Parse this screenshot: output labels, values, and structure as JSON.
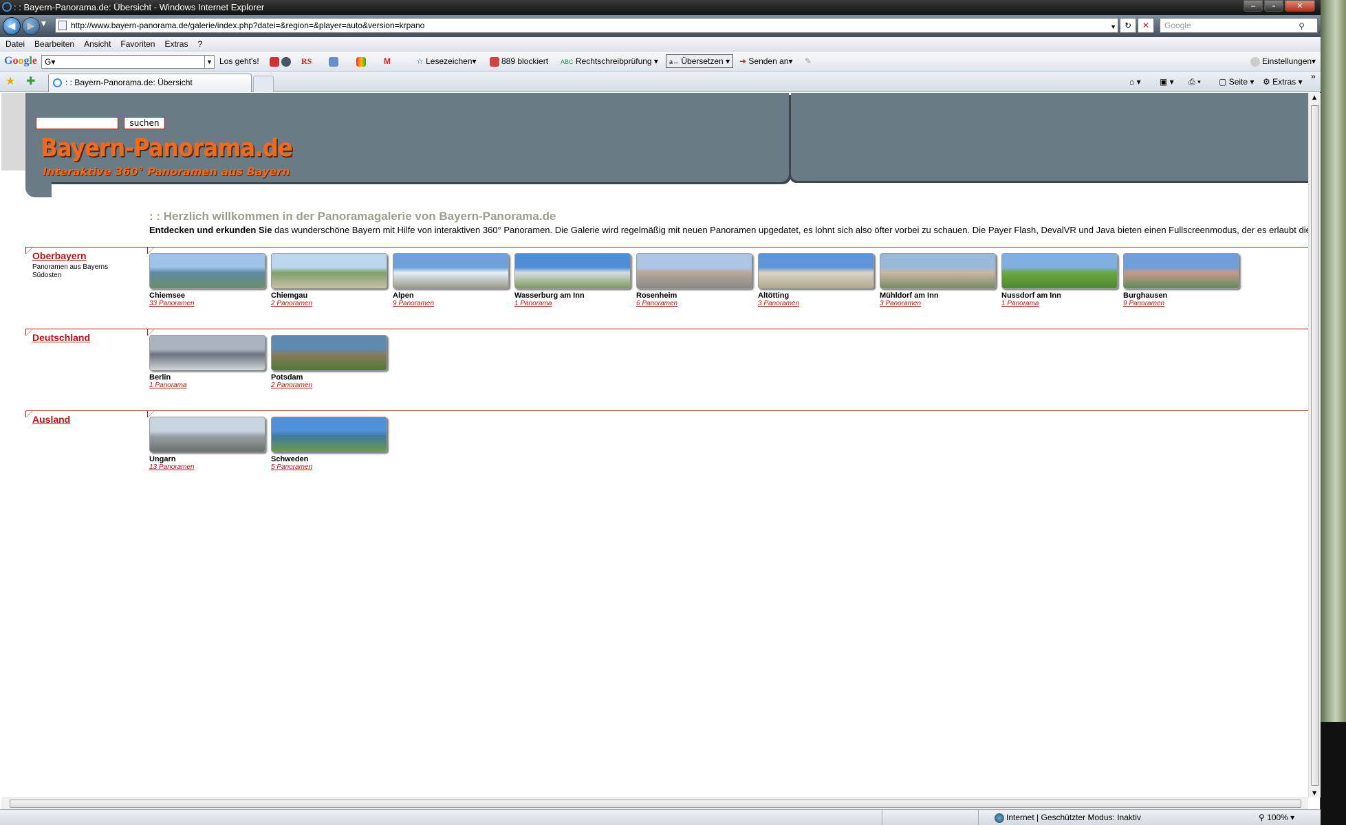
{
  "window": {
    "title": ": : Bayern-Panorama.de: Übersicht - Windows Internet Explorer"
  },
  "address": {
    "url": "http://www.bayern-panorama.de/galerie/index.php?datei=&region=&player=auto&version=krpano",
    "search_placeholder": "Google"
  },
  "menu": [
    "Datei",
    "Bearbeiten",
    "Ansicht",
    "Favoriten",
    "Extras",
    "?"
  ],
  "gbar": {
    "logo": "Google",
    "input": "G▾",
    "go": "Los geht's!",
    "rs": "RS",
    "bookmarks": "Lesezeichen▾",
    "blocked": "889 blockiert",
    "spell": "Rechtschreibprüfung",
    "translate": "Übersetzen",
    "send": "Senden an▾",
    "settings": "Einstellungen▾"
  },
  "tab": {
    "label": ": : Bayern-Panorama.de: Übersicht"
  },
  "cmdbar": {
    "page": "Seite",
    "extras": "Extras"
  },
  "site": {
    "search_button": "suchen",
    "logo": "Bayern-Panorama.de",
    "logo_sub": "Interaktive 360° Panoramen aus Bayern",
    "welcome": ": : Herzlich willkommen in der Panoramagalerie von Bayern-Panorama.de",
    "intro_bold": "Entdecken und erkunden Sie",
    "intro_rest": " das wunderschöne Bayern mit Hilfe von interaktiven 360° Panoramen. Die Galerie wird regelmäßig mit neuen Panoramen upgedatet, es lohnt sich also öfter vorbei zu schauen. Die Payer Flash, DevalVR und Java bieten einen Fullscreenmodus, der es erlaubt die"
  },
  "sections": [
    {
      "title": "Oberbayern",
      "desc": "Panoramen aus Bayerns Südosten",
      "items": [
        {
          "name": "Chiemsee",
          "count": "33 Panoramen",
          "colors": [
            "#9fc2e8",
            "#5e8aa0",
            "#6b8f70"
          ]
        },
        {
          "name": "Chiemgau",
          "count": "2 Panoramen",
          "colors": [
            "#bcd6ee",
            "#7fa06a",
            "#c8c0a8"
          ]
        },
        {
          "name": "Alpen",
          "count": "9 Panoramen",
          "colors": [
            "#6fa0d8",
            "#e6eef4",
            "#9a9a8c"
          ]
        },
        {
          "name": "Wasserburg am Inn",
          "count": "1 Panorama",
          "colors": [
            "#4f8ed6",
            "#d8dde0",
            "#7f9a5e"
          ]
        },
        {
          "name": "Rosenheim",
          "count": "6 Panoramen",
          "colors": [
            "#aec6e6",
            "#b7a89a",
            "#8a8a88"
          ]
        },
        {
          "name": "Altötting",
          "count": "3 Panoramen",
          "colors": [
            "#5f94d6",
            "#dcd4c4",
            "#b0a890"
          ]
        },
        {
          "name": "Mühldorf am Inn",
          "count": "3 Panoramen",
          "colors": [
            "#9ab8d8",
            "#c8b8a0",
            "#7a8a6a"
          ]
        },
        {
          "name": "Nussdorf am Inn",
          "count": "1 Panorama",
          "colors": [
            "#7fb0e0",
            "#6aa840",
            "#4f8a30"
          ]
        },
        {
          "name": "Burghausen",
          "count": "9 Panoramen",
          "colors": [
            "#6f9ed8",
            "#c89a8a",
            "#5f8a5a"
          ]
        }
      ]
    },
    {
      "title": "Deutschland",
      "desc": "",
      "items": [
        {
          "name": "Berlin",
          "count": "1 Panorama",
          "colors": [
            "#aab4c0",
            "#6a7480",
            "#d0d4d8"
          ]
        },
        {
          "name": "Potsdam",
          "count": "2 Panoramen",
          "colors": [
            "#5f8ab0",
            "#8a7a5a",
            "#4f7a3a"
          ]
        }
      ]
    },
    {
      "title": "Ausland",
      "desc": "",
      "items": [
        {
          "name": "Ungarn",
          "count": "13 Panoramen",
          "colors": [
            "#c8d4e0",
            "#9a9ea4",
            "#6a7070"
          ]
        },
        {
          "name": "Schweden",
          "count": "5 Panoramen",
          "colors": [
            "#4f90d8",
            "#3f7aa0",
            "#6a9a4a"
          ]
        }
      ]
    }
  ],
  "status": {
    "zone": "Internet | Geschützter Modus: Inaktiv",
    "zoom": "100%"
  }
}
